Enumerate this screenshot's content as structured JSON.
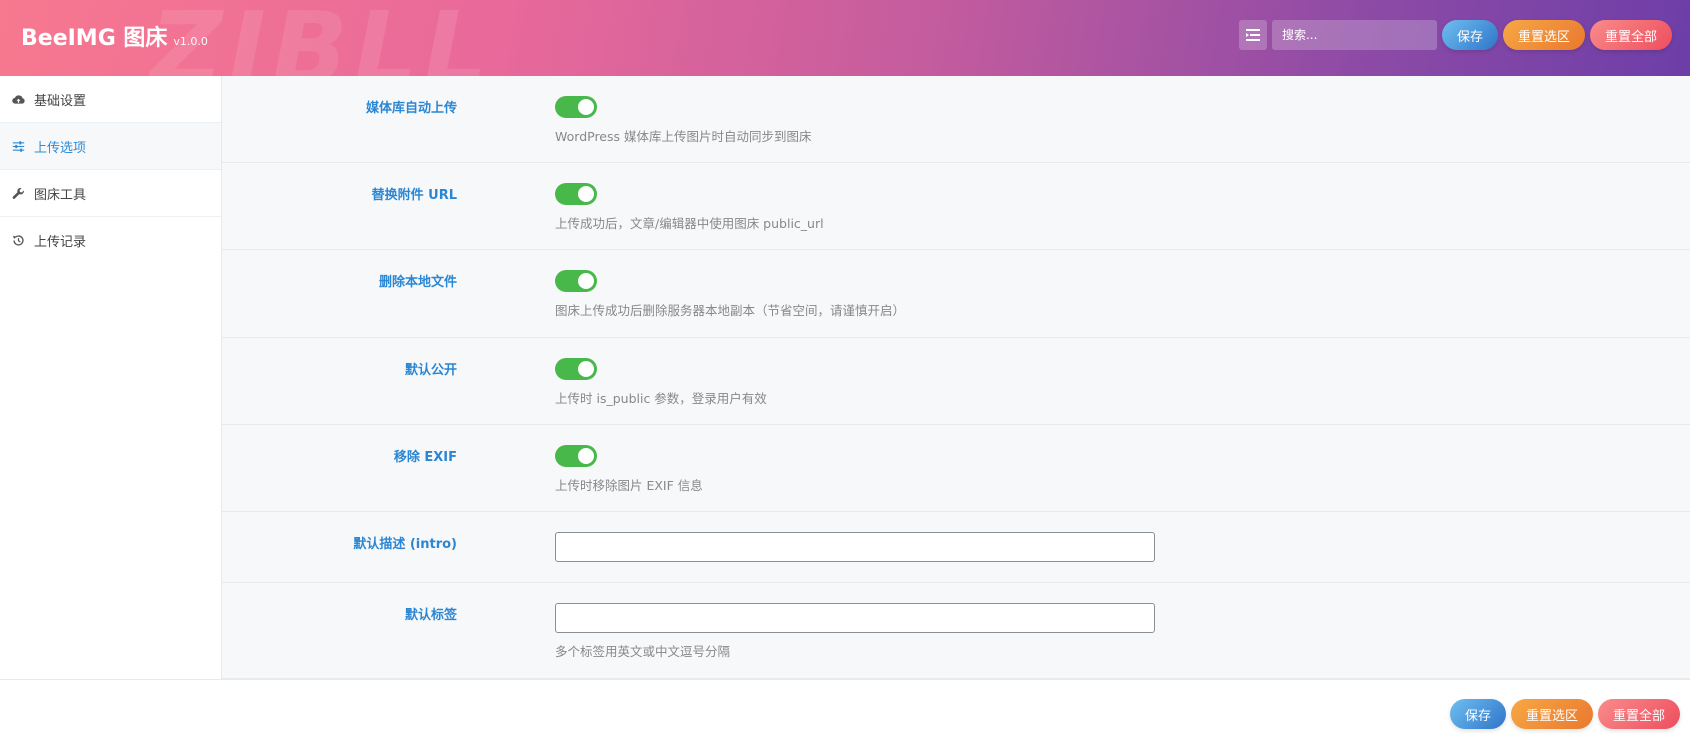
{
  "header": {
    "title": "BeeIMG 图床",
    "version": "v1.0.0",
    "watermark": "ZIBLL",
    "search_placeholder": "搜索...",
    "save_label": "保存",
    "reset_section_label": "重置选区",
    "reset_all_label": "重置全部"
  },
  "sidebar": {
    "items": [
      {
        "label": "基础设置",
        "icon": "cloud-upload-icon"
      },
      {
        "label": "上传选项",
        "icon": "sliders-icon"
      },
      {
        "label": "图床工具",
        "icon": "wrench-icon"
      },
      {
        "label": "上传记录",
        "icon": "history-icon"
      }
    ],
    "active_index": 1
  },
  "settings": [
    {
      "label": "媒体库自动上传",
      "type": "toggle",
      "value": true,
      "description": "WordPress 媒体库上传图片时自动同步到图床"
    },
    {
      "label": "替换附件 URL",
      "type": "toggle",
      "value": true,
      "description": "上传成功后，文章/编辑器中使用图床 public_url"
    },
    {
      "label": "删除本地文件",
      "type": "toggle",
      "value": true,
      "description": "图床上传成功后删除服务器本地副本（节省空间，请谨慎开启）"
    },
    {
      "label": "默认公开",
      "type": "toggle",
      "value": true,
      "description": "上传时 is_public 参数，登录用户有效"
    },
    {
      "label": "移除 EXIF",
      "type": "toggle",
      "value": true,
      "description": "上传时移除图片 EXIF 信息"
    },
    {
      "label": "默认描述 (intro)",
      "type": "text",
      "value": "",
      "description": ""
    },
    {
      "label": "默认标签",
      "type": "text",
      "value": "",
      "description": "多个标签用英文或中文逗号分隔"
    }
  ],
  "footer": {
    "save_label": "保存",
    "reset_section_label": "重置选区",
    "reset_all_label": "重置全部"
  },
  "colors": {
    "accent_blue": "#2b87d3",
    "toggle_on": "#48b84a",
    "save_gradient_end": "#2f74c9",
    "reset_section": "#e9782f",
    "reset_all": "#ee4e5e"
  }
}
